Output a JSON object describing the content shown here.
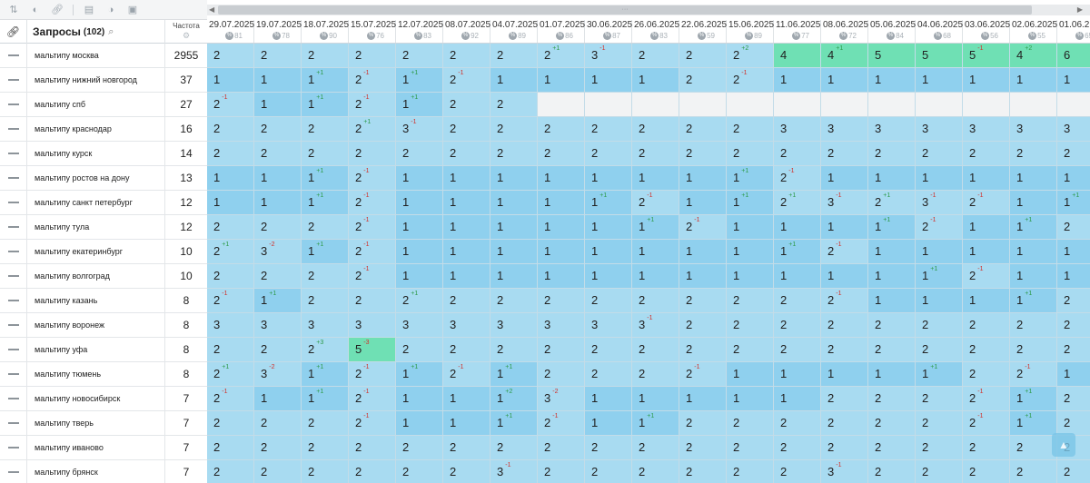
{
  "header": {
    "queries_title": "Запросы",
    "queries_count": "(102)",
    "frequency_label": "Частота"
  },
  "colors": {
    "pos1": "#8fd0ee",
    "pos2_3": "#a8dbf1",
    "pos4_plus": "#6fe0b4",
    "up": "#2e9b4a",
    "down": "#d2312b"
  },
  "dates": [
    {
      "date": "29.07.2025",
      "num": "81"
    },
    {
      "date": "19.07.2025",
      "num": "78"
    },
    {
      "date": "18.07.2025",
      "num": "90"
    },
    {
      "date": "15.07.2025",
      "num": "76"
    },
    {
      "date": "12.07.2025",
      "num": "83"
    },
    {
      "date": "08.07.2025",
      "num": "92"
    },
    {
      "date": "04.07.2025",
      "num": "89"
    },
    {
      "date": "01.07.2025",
      "num": "86"
    },
    {
      "date": "30.06.2025",
      "num": "87"
    },
    {
      "date": "26.06.2025",
      "num": "83"
    },
    {
      "date": "22.06.2025",
      "num": "59"
    },
    {
      "date": "15.06.2025",
      "num": "89"
    },
    {
      "date": "11.06.2025",
      "num": "77"
    },
    {
      "date": "08.06.2025",
      "num": "72"
    },
    {
      "date": "05.06.2025",
      "num": "84"
    },
    {
      "date": "04.06.2025",
      "num": "68"
    },
    {
      "date": "03.06.2025",
      "num": "56"
    },
    {
      "date": "02.06.2025",
      "num": "55"
    },
    {
      "date": "01.06.2",
      "num": "65"
    }
  ],
  "rows": [
    {
      "query": "мальтипу москва",
      "freq": "2955",
      "cells": [
        [
          "2",
          ""
        ],
        [
          "2",
          ""
        ],
        [
          "2",
          ""
        ],
        [
          "2",
          ""
        ],
        [
          "2",
          ""
        ],
        [
          "2",
          ""
        ],
        [
          "2",
          ""
        ],
        [
          "2",
          "+1"
        ],
        [
          "3",
          "-1"
        ],
        [
          "2",
          ""
        ],
        [
          "2",
          ""
        ],
        [
          "2",
          "+2"
        ],
        [
          "4",
          ""
        ],
        [
          "4",
          "+1"
        ],
        [
          "5",
          ""
        ],
        [
          "5",
          ""
        ],
        [
          "5",
          "-1"
        ],
        [
          "4",
          "+2"
        ],
        [
          "6",
          ""
        ]
      ]
    },
    {
      "query": "мальтипу нижний новгород",
      "freq": "37",
      "cells": [
        [
          "1",
          ""
        ],
        [
          "1",
          ""
        ],
        [
          "1",
          "+1"
        ],
        [
          "2",
          "-1"
        ],
        [
          "1",
          "+1"
        ],
        [
          "2",
          "-1"
        ],
        [
          "1",
          ""
        ],
        [
          "1",
          ""
        ],
        [
          "1",
          ""
        ],
        [
          "1",
          ""
        ],
        [
          "2",
          ""
        ],
        [
          "2",
          "-1"
        ],
        [
          "1",
          ""
        ],
        [
          "1",
          ""
        ],
        [
          "1",
          ""
        ],
        [
          "1",
          ""
        ],
        [
          "1",
          ""
        ],
        [
          "1",
          ""
        ],
        [
          "1",
          ""
        ]
      ]
    },
    {
      "query": "мальтипу спб",
      "freq": "27",
      "cells": [
        [
          "2",
          "-1"
        ],
        [
          "1",
          ""
        ],
        [
          "1",
          "+1"
        ],
        [
          "2",
          "-1"
        ],
        [
          "1",
          "+1"
        ],
        [
          "2",
          ""
        ],
        [
          "2",
          ""
        ],
        [
          "",
          ""
        ],
        [
          "",
          ""
        ],
        [
          "",
          ""
        ],
        [
          "",
          ""
        ],
        [
          "",
          ""
        ],
        [
          "",
          ""
        ],
        [
          "",
          ""
        ],
        [
          "",
          ""
        ],
        [
          "",
          ""
        ],
        [
          "",
          ""
        ],
        [
          "",
          ""
        ],
        [
          "",
          ""
        ]
      ]
    },
    {
      "query": "мальтипу краснодар",
      "freq": "16",
      "cells": [
        [
          "2",
          ""
        ],
        [
          "2",
          ""
        ],
        [
          "2",
          ""
        ],
        [
          "2",
          "+1"
        ],
        [
          "3",
          "-1"
        ],
        [
          "2",
          ""
        ],
        [
          "2",
          ""
        ],
        [
          "2",
          ""
        ],
        [
          "2",
          ""
        ],
        [
          "2",
          ""
        ],
        [
          "2",
          ""
        ],
        [
          "2",
          ""
        ],
        [
          "3",
          ""
        ],
        [
          "3",
          ""
        ],
        [
          "3",
          ""
        ],
        [
          "3",
          ""
        ],
        [
          "3",
          ""
        ],
        [
          "3",
          ""
        ],
        [
          "3",
          ""
        ]
      ]
    },
    {
      "query": "мальтипу курск",
      "freq": "14",
      "cells": [
        [
          "2",
          ""
        ],
        [
          "2",
          ""
        ],
        [
          "2",
          ""
        ],
        [
          "2",
          ""
        ],
        [
          "2",
          ""
        ],
        [
          "2",
          ""
        ],
        [
          "2",
          ""
        ],
        [
          "2",
          ""
        ],
        [
          "2",
          ""
        ],
        [
          "2",
          ""
        ],
        [
          "2",
          ""
        ],
        [
          "2",
          ""
        ],
        [
          "2",
          ""
        ],
        [
          "2",
          ""
        ],
        [
          "2",
          ""
        ],
        [
          "2",
          ""
        ],
        [
          "2",
          ""
        ],
        [
          "2",
          ""
        ],
        [
          "2",
          ""
        ]
      ]
    },
    {
      "query": "мальтипу ростов на дону",
      "freq": "13",
      "cells": [
        [
          "1",
          ""
        ],
        [
          "1",
          ""
        ],
        [
          "1",
          "+1"
        ],
        [
          "2",
          "-1"
        ],
        [
          "1",
          ""
        ],
        [
          "1",
          ""
        ],
        [
          "1",
          ""
        ],
        [
          "1",
          ""
        ],
        [
          "1",
          ""
        ],
        [
          "1",
          ""
        ],
        [
          "1",
          ""
        ],
        [
          "1",
          "+1"
        ],
        [
          "2",
          "-1"
        ],
        [
          "1",
          ""
        ],
        [
          "1",
          ""
        ],
        [
          "1",
          ""
        ],
        [
          "1",
          ""
        ],
        [
          "1",
          ""
        ],
        [
          "1",
          ""
        ]
      ]
    },
    {
      "query": "мальтипу санкт петербург",
      "freq": "12",
      "cells": [
        [
          "1",
          ""
        ],
        [
          "1",
          ""
        ],
        [
          "1",
          "+1"
        ],
        [
          "2",
          "-1"
        ],
        [
          "1",
          ""
        ],
        [
          "1",
          ""
        ],
        [
          "1",
          ""
        ],
        [
          "1",
          ""
        ],
        [
          "1",
          "+1"
        ],
        [
          "2",
          "-1"
        ],
        [
          "1",
          ""
        ],
        [
          "1",
          "+1"
        ],
        [
          "2",
          "+1"
        ],
        [
          "3",
          "-1"
        ],
        [
          "2",
          "+1"
        ],
        [
          "3",
          "-1"
        ],
        [
          "2",
          "-1"
        ],
        [
          "1",
          ""
        ],
        [
          "1",
          "+1"
        ]
      ]
    },
    {
      "query": "мальтипу тула",
      "freq": "12",
      "cells": [
        [
          "2",
          ""
        ],
        [
          "2",
          ""
        ],
        [
          "2",
          ""
        ],
        [
          "2",
          "-1"
        ],
        [
          "1",
          ""
        ],
        [
          "1",
          ""
        ],
        [
          "1",
          ""
        ],
        [
          "1",
          ""
        ],
        [
          "1",
          ""
        ],
        [
          "1",
          "+1"
        ],
        [
          "2",
          "-1"
        ],
        [
          "1",
          ""
        ],
        [
          "1",
          ""
        ],
        [
          "1",
          ""
        ],
        [
          "1",
          "+1"
        ],
        [
          "2",
          "-1"
        ],
        [
          "1",
          ""
        ],
        [
          "1",
          "+1"
        ],
        [
          "2",
          ""
        ]
      ]
    },
    {
      "query": "мальтипу екатеринбург",
      "freq": "10",
      "cells": [
        [
          "2",
          "+1"
        ],
        [
          "3",
          "-2"
        ],
        [
          "1",
          "+1"
        ],
        [
          "2",
          "-1"
        ],
        [
          "1",
          ""
        ],
        [
          "1",
          ""
        ],
        [
          "1",
          ""
        ],
        [
          "1",
          ""
        ],
        [
          "1",
          ""
        ],
        [
          "1",
          ""
        ],
        [
          "1",
          ""
        ],
        [
          "1",
          ""
        ],
        [
          "1",
          "+1"
        ],
        [
          "2",
          "-1"
        ],
        [
          "1",
          ""
        ],
        [
          "1",
          ""
        ],
        [
          "1",
          ""
        ],
        [
          "1",
          ""
        ],
        [
          "1",
          ""
        ]
      ]
    },
    {
      "query": "мальтипу волгоград",
      "freq": "10",
      "cells": [
        [
          "2",
          ""
        ],
        [
          "2",
          ""
        ],
        [
          "2",
          ""
        ],
        [
          "2",
          "-1"
        ],
        [
          "1",
          ""
        ],
        [
          "1",
          ""
        ],
        [
          "1",
          ""
        ],
        [
          "1",
          ""
        ],
        [
          "1",
          ""
        ],
        [
          "1",
          ""
        ],
        [
          "1",
          ""
        ],
        [
          "1",
          ""
        ],
        [
          "1",
          ""
        ],
        [
          "1",
          ""
        ],
        [
          "1",
          ""
        ],
        [
          "1",
          "+1"
        ],
        [
          "2",
          "-1"
        ],
        [
          "1",
          ""
        ],
        [
          "1",
          ""
        ]
      ]
    },
    {
      "query": "мальтипу казань",
      "freq": "8",
      "cells": [
        [
          "2",
          "-1"
        ],
        [
          "1",
          "+1"
        ],
        [
          "2",
          ""
        ],
        [
          "2",
          ""
        ],
        [
          "2",
          "+1"
        ],
        [
          "2",
          ""
        ],
        [
          "2",
          ""
        ],
        [
          "2",
          ""
        ],
        [
          "2",
          ""
        ],
        [
          "2",
          ""
        ],
        [
          "2",
          ""
        ],
        [
          "2",
          ""
        ],
        [
          "2",
          ""
        ],
        [
          "2",
          "-1"
        ],
        [
          "1",
          ""
        ],
        [
          "1",
          ""
        ],
        [
          "1",
          ""
        ],
        [
          "1",
          "+1"
        ],
        [
          "2",
          ""
        ]
      ]
    },
    {
      "query": "мальтипу воронеж",
      "freq": "8",
      "cells": [
        [
          "3",
          ""
        ],
        [
          "3",
          ""
        ],
        [
          "3",
          ""
        ],
        [
          "3",
          ""
        ],
        [
          "3",
          ""
        ],
        [
          "3",
          ""
        ],
        [
          "3",
          ""
        ],
        [
          "3",
          ""
        ],
        [
          "3",
          ""
        ],
        [
          "3",
          "-1"
        ],
        [
          "2",
          ""
        ],
        [
          "2",
          ""
        ],
        [
          "2",
          ""
        ],
        [
          "2",
          ""
        ],
        [
          "2",
          ""
        ],
        [
          "2",
          ""
        ],
        [
          "2",
          ""
        ],
        [
          "2",
          ""
        ],
        [
          "2",
          ""
        ]
      ]
    },
    {
      "query": "мальтипу уфа",
      "freq": "8",
      "cells": [
        [
          "2",
          ""
        ],
        [
          "2",
          ""
        ],
        [
          "2",
          "+3"
        ],
        [
          "5",
          "-3"
        ],
        [
          "2",
          ""
        ],
        [
          "2",
          ""
        ],
        [
          "2",
          ""
        ],
        [
          "2",
          ""
        ],
        [
          "2",
          ""
        ],
        [
          "2",
          ""
        ],
        [
          "2",
          ""
        ],
        [
          "2",
          ""
        ],
        [
          "2",
          ""
        ],
        [
          "2",
          ""
        ],
        [
          "2",
          ""
        ],
        [
          "2",
          ""
        ],
        [
          "2",
          ""
        ],
        [
          "2",
          ""
        ],
        [
          "2",
          ""
        ]
      ]
    },
    {
      "query": "мальтипу тюмень",
      "freq": "8",
      "cells": [
        [
          "2",
          "+1"
        ],
        [
          "3",
          "-2"
        ],
        [
          "1",
          "+1"
        ],
        [
          "2",
          "-1"
        ],
        [
          "1",
          "+1"
        ],
        [
          "2",
          "-1"
        ],
        [
          "1",
          "+1"
        ],
        [
          "2",
          ""
        ],
        [
          "2",
          ""
        ],
        [
          "2",
          ""
        ],
        [
          "2",
          "-1"
        ],
        [
          "1",
          ""
        ],
        [
          "1",
          ""
        ],
        [
          "1",
          ""
        ],
        [
          "1",
          ""
        ],
        [
          "1",
          "+1"
        ],
        [
          "2",
          ""
        ],
        [
          "2",
          "-1"
        ],
        [
          "1",
          ""
        ]
      ]
    },
    {
      "query": "мальтипу новосибирск",
      "freq": "7",
      "cells": [
        [
          "2",
          "-1"
        ],
        [
          "1",
          ""
        ],
        [
          "1",
          "+1"
        ],
        [
          "2",
          "-1"
        ],
        [
          "1",
          ""
        ],
        [
          "1",
          ""
        ],
        [
          "1",
          "+2"
        ],
        [
          "3",
          "-2"
        ],
        [
          "1",
          ""
        ],
        [
          "1",
          ""
        ],
        [
          "1",
          ""
        ],
        [
          "1",
          ""
        ],
        [
          "1",
          ""
        ],
        [
          "2",
          ""
        ],
        [
          "2",
          ""
        ],
        [
          "2",
          ""
        ],
        [
          "2",
          "-1"
        ],
        [
          "1",
          "+1"
        ],
        [
          "2",
          ""
        ]
      ]
    },
    {
      "query": "мальтипу тверь",
      "freq": "7",
      "cells": [
        [
          "2",
          ""
        ],
        [
          "2",
          ""
        ],
        [
          "2",
          ""
        ],
        [
          "2",
          "-1"
        ],
        [
          "1",
          ""
        ],
        [
          "1",
          ""
        ],
        [
          "1",
          "+1"
        ],
        [
          "2",
          "-1"
        ],
        [
          "1",
          ""
        ],
        [
          "1",
          "+1"
        ],
        [
          "2",
          ""
        ],
        [
          "2",
          ""
        ],
        [
          "2",
          ""
        ],
        [
          "2",
          ""
        ],
        [
          "2",
          ""
        ],
        [
          "2",
          ""
        ],
        [
          "2",
          "-1"
        ],
        [
          "1",
          "+1"
        ],
        [
          "2",
          ""
        ]
      ]
    },
    {
      "query": "мальтипу иваново",
      "freq": "7",
      "cells": [
        [
          "2",
          ""
        ],
        [
          "2",
          ""
        ],
        [
          "2",
          ""
        ],
        [
          "2",
          ""
        ],
        [
          "2",
          ""
        ],
        [
          "2",
          ""
        ],
        [
          "2",
          ""
        ],
        [
          "2",
          ""
        ],
        [
          "2",
          ""
        ],
        [
          "2",
          ""
        ],
        [
          "2",
          ""
        ],
        [
          "2",
          ""
        ],
        [
          "2",
          ""
        ],
        [
          "2",
          ""
        ],
        [
          "2",
          ""
        ],
        [
          "2",
          ""
        ],
        [
          "2",
          ""
        ],
        [
          "2",
          ""
        ],
        [
          "2",
          ""
        ]
      ]
    },
    {
      "query": "мальтипу брянск",
      "freq": "7",
      "cells": [
        [
          "2",
          ""
        ],
        [
          "2",
          ""
        ],
        [
          "2",
          ""
        ],
        [
          "2",
          ""
        ],
        [
          "2",
          ""
        ],
        [
          "2",
          ""
        ],
        [
          "3",
          "-1"
        ],
        [
          "2",
          ""
        ],
        [
          "2",
          ""
        ],
        [
          "2",
          ""
        ],
        [
          "2",
          ""
        ],
        [
          "2",
          ""
        ],
        [
          "2",
          ""
        ],
        [
          "3",
          "-1"
        ],
        [
          "2",
          ""
        ],
        [
          "2",
          ""
        ],
        [
          "2",
          ""
        ],
        [
          "2",
          ""
        ],
        [
          "2",
          ""
        ]
      ]
    }
  ]
}
